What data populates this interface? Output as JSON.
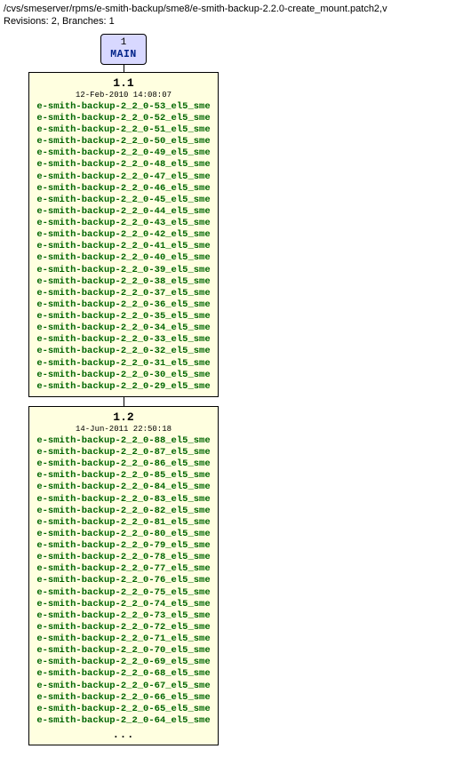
{
  "header": {
    "path": "/cvs/smeserver/rpms/e-smith-backup/sme8/e-smith-backup-2.2.0-create_mount.patch2,v",
    "info": "Revisions: 2, Branches: 1"
  },
  "branch": {
    "number": "1",
    "name": "MAIN"
  },
  "revisions": [
    {
      "number": "1.1",
      "date": "12-Feb-2010 14:08:07",
      "tags": [
        "e-smith-backup-2_2_0-53_el5_sme",
        "e-smith-backup-2_2_0-52_el5_sme",
        "e-smith-backup-2_2_0-51_el5_sme",
        "e-smith-backup-2_2_0-50_el5_sme",
        "e-smith-backup-2_2_0-49_el5_sme",
        "e-smith-backup-2_2_0-48_el5_sme",
        "e-smith-backup-2_2_0-47_el5_sme",
        "e-smith-backup-2_2_0-46_el5_sme",
        "e-smith-backup-2_2_0-45_el5_sme",
        "e-smith-backup-2_2_0-44_el5_sme",
        "e-smith-backup-2_2_0-43_el5_sme",
        "e-smith-backup-2_2_0-42_el5_sme",
        "e-smith-backup-2_2_0-41_el5_sme",
        "e-smith-backup-2_2_0-40_el5_sme",
        "e-smith-backup-2_2_0-39_el5_sme",
        "e-smith-backup-2_2_0-38_el5_sme",
        "e-smith-backup-2_2_0-37_el5_sme",
        "e-smith-backup-2_2_0-36_el5_sme",
        "e-smith-backup-2_2_0-35_el5_sme",
        "e-smith-backup-2_2_0-34_el5_sme",
        "e-smith-backup-2_2_0-33_el5_sme",
        "e-smith-backup-2_2_0-32_el5_sme",
        "e-smith-backup-2_2_0-31_el5_sme",
        "e-smith-backup-2_2_0-30_el5_sme",
        "e-smith-backup-2_2_0-29_el5_sme"
      ]
    },
    {
      "number": "1.2",
      "date": "14-Jun-2011 22:50:18",
      "tags": [
        "e-smith-backup-2_2_0-88_el5_sme",
        "e-smith-backup-2_2_0-87_el5_sme",
        "e-smith-backup-2_2_0-86_el5_sme",
        "e-smith-backup-2_2_0-85_el5_sme",
        "e-smith-backup-2_2_0-84_el5_sme",
        "e-smith-backup-2_2_0-83_el5_sme",
        "e-smith-backup-2_2_0-82_el5_sme",
        "e-smith-backup-2_2_0-81_el5_sme",
        "e-smith-backup-2_2_0-80_el5_sme",
        "e-smith-backup-2_2_0-79_el5_sme",
        "e-smith-backup-2_2_0-78_el5_sme",
        "e-smith-backup-2_2_0-77_el5_sme",
        "e-smith-backup-2_2_0-76_el5_sme",
        "e-smith-backup-2_2_0-75_el5_sme",
        "e-smith-backup-2_2_0-74_el5_sme",
        "e-smith-backup-2_2_0-73_el5_sme",
        "e-smith-backup-2_2_0-72_el5_sme",
        "e-smith-backup-2_2_0-71_el5_sme",
        "e-smith-backup-2_2_0-70_el5_sme",
        "e-smith-backup-2_2_0-69_el5_sme",
        "e-smith-backup-2_2_0-68_el5_sme",
        "e-smith-backup-2_2_0-67_el5_sme",
        "e-smith-backup-2_2_0-66_el5_sme",
        "e-smith-backup-2_2_0-65_el5_sme",
        "e-smith-backup-2_2_0-64_el5_sme"
      ],
      "truncated": true
    }
  ],
  "ellipsis": "..."
}
